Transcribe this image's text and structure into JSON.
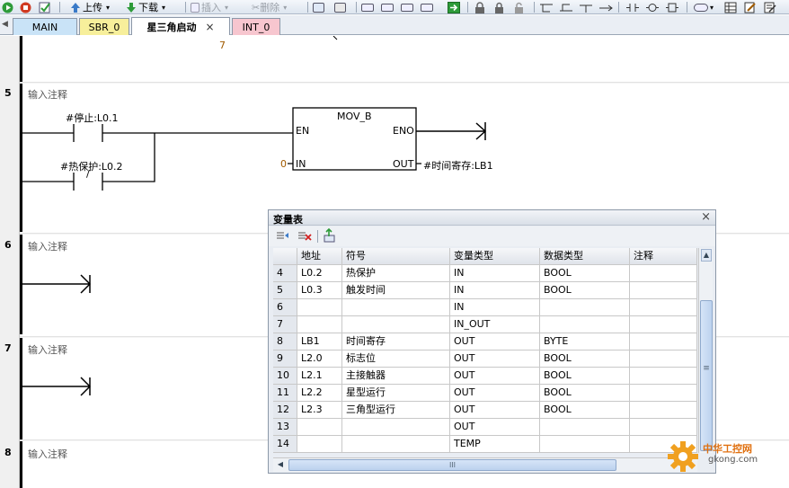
{
  "toolbar": {
    "upload_label": "上传",
    "download_label": "下载",
    "insert_label": "插入",
    "delete_label": "删除"
  },
  "tabs": [
    {
      "label": "MAIN"
    },
    {
      "label": "SBR_0"
    },
    {
      "label": "星三角启动"
    },
    {
      "label": "INT_0"
    }
  ],
  "tab_close": "×",
  "ladder": {
    "prev_network_digit": "7",
    "networks": [
      {
        "number": "5",
        "comment": "输入注释"
      },
      {
        "number": "6",
        "comment": "输入注释"
      },
      {
        "number": "7",
        "comment": "输入注释"
      },
      {
        "number": "8",
        "comment": "输入注释"
      }
    ],
    "contact1_label": "#停止:L0.1",
    "contact2_label": "#热保护:L0.2",
    "contact2_symbol": "/",
    "block": {
      "name": "MOV_B",
      "en": "EN",
      "eno": "ENO",
      "in": "IN",
      "out": "OUT",
      "in_value": "0",
      "out_operand": "#时间寄存:LB1"
    }
  },
  "var_table": {
    "title": "变量表",
    "close": "×",
    "columns": [
      "",
      "地址",
      "符号",
      "变量类型",
      "数据类型",
      "注释"
    ],
    "rows": [
      [
        "4",
        "L0.2",
        "热保护",
        "IN",
        "BOOL",
        ""
      ],
      [
        "5",
        "L0.3",
        "触发时间",
        "IN",
        "BOOL",
        ""
      ],
      [
        "6",
        "",
        "",
        "IN",
        "",
        ""
      ],
      [
        "7",
        "",
        "",
        "IN_OUT",
        "",
        ""
      ],
      [
        "8",
        "LB1",
        "时间寄存",
        "OUT",
        "BYTE",
        ""
      ],
      [
        "9",
        "L2.0",
        "标志位",
        "OUT",
        "BOOL",
        ""
      ],
      [
        "10",
        "L2.1",
        "主接触器",
        "OUT",
        "BOOL",
        ""
      ],
      [
        "11",
        "L2.2",
        "星型运行",
        "OUT",
        "BOOL",
        ""
      ],
      [
        "12",
        "L2.3",
        "三角型运行",
        "OUT",
        "BOOL",
        ""
      ],
      [
        "13",
        "",
        "",
        "OUT",
        "",
        ""
      ],
      [
        "14",
        "",
        "",
        "TEMP",
        "",
        ""
      ]
    ],
    "hscroll_grip": "III",
    "vscroll_grip": "≡"
  },
  "watermark": {
    "cn": "中华工控网",
    "url": "gkong.com"
  },
  "colors": {
    "tab_main": "#c9e3f7",
    "tab_sbr": "#f7ef9b",
    "tab_active": "#ffffff",
    "tab_int": "#f7c6cf",
    "accent": "#3a7ac8"
  }
}
